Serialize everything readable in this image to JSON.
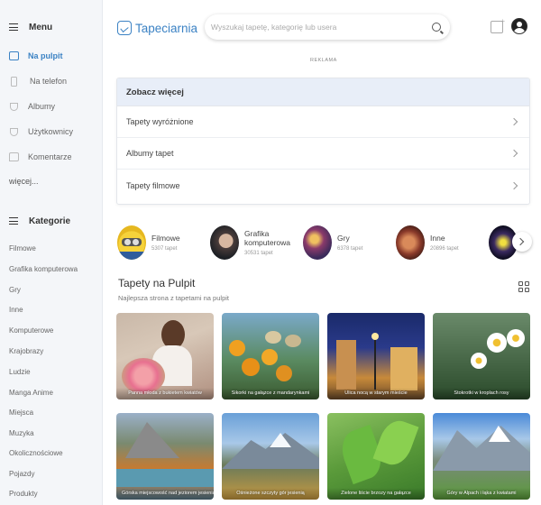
{
  "sidebar": {
    "menu_title": "Menu",
    "items": [
      {
        "label": "Na pulpit",
        "active": true
      },
      {
        "label": "Na telefon"
      },
      {
        "label": "Albumy"
      },
      {
        "label": "Użytkownicy"
      },
      {
        "label": "Komentarze"
      }
    ],
    "more": "więcej...",
    "categories_title": "Kategorie",
    "categories": [
      "Filmowe",
      "Grafika komputerowa",
      "Gry",
      "Inne",
      "Komputerowe",
      "Krajobrazy",
      "Ludzie",
      "Manga Anime",
      "Miejsca",
      "Muzyka",
      "Okolicznościowe",
      "Pojazdy",
      "Produkty"
    ]
  },
  "header": {
    "logo": "Tapeciarnia",
    "search_placeholder": "Wyszukaj tapetę, kategorię lub usera"
  },
  "ad_label": "REKLAMA",
  "see_more": {
    "title": "Zobacz więcej",
    "rows": [
      "Tapety wyróżnione",
      "Albumy tapet",
      "Tapety filmowe"
    ]
  },
  "category_cards": [
    {
      "name": "Filmowe",
      "count": "5307 tapet"
    },
    {
      "name": "Grafika komputerowa",
      "count": "30531 tapet"
    },
    {
      "name": "Gry",
      "count": "6378 tapet"
    },
    {
      "name": "Inne",
      "count": "20896 tapet"
    }
  ],
  "section": {
    "title": "Tapety na Pulpit",
    "subtitle": "Najlepsza strona z tapetami na pulpit"
  },
  "tiles": [
    {
      "caption": "Panna młoda z bukietem kwiatów"
    },
    {
      "caption": "Sikorki na gałązce z mandarynkami"
    },
    {
      "caption": "Ulica nocą w starym mieście"
    },
    {
      "caption": "Stokrotki w kroplach rosy"
    },
    {
      "caption": "Górska miejscowość nad jeziorem jesienią"
    },
    {
      "caption": "Ośnieżone szczyty gór jesienią"
    },
    {
      "caption": "Zielone liście brzozy na gałązce"
    },
    {
      "caption": "Góry w Alpach i łąka z kwiatami"
    }
  ],
  "colors": {
    "accent": "#3b82c4",
    "sidebar_bg": "#f4f6f9",
    "card_head_bg": "#e8eef8"
  }
}
